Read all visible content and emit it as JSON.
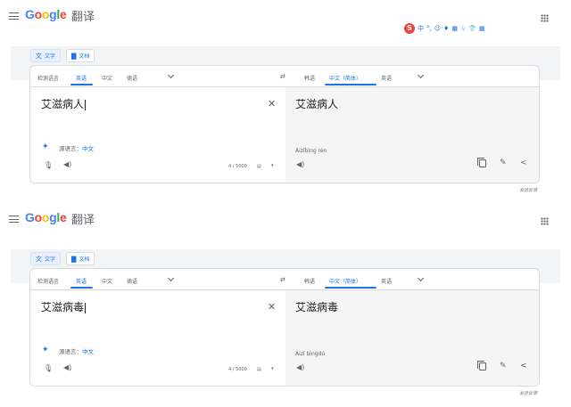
{
  "header": {
    "logo_parts": [
      "G",
      "o",
      "o",
      "g",
      "l",
      "e"
    ],
    "product": "翻译",
    "ime": {
      "brand": "S",
      "items": [
        "中",
        "°,",
        "☺",
        "♦",
        "▦",
        "♧",
        "👕",
        "▦"
      ]
    }
  },
  "modes": {
    "text": "文字",
    "docs": "文档"
  },
  "panels": [
    {
      "source_tabs": [
        "检测语言",
        "英语",
        "中文",
        "德语"
      ],
      "source_active": 1,
      "target_tabs": [
        "韩语",
        "中文（简体）",
        "英语"
      ],
      "target_active": 1,
      "source_text": "艾滋病人",
      "detected_label": "源语言：",
      "detected_lang": "中文",
      "char_count": "4 / 5000",
      "target_text": "艾滋病人",
      "pinyin": "Àizībìng rén",
      "feedback": "发送反馈"
    },
    {
      "source_tabs": [
        "检测语言",
        "英语",
        "中文",
        "德语"
      ],
      "source_active": 1,
      "target_tabs": [
        "韩语",
        "中文（简体）",
        "英语"
      ],
      "target_active": 1,
      "source_text": "艾滋病毒",
      "detected_label": "源语言：",
      "detected_lang": "中文",
      "char_count": "4 / 5000",
      "target_text": "艾滋病毒",
      "pinyin": "Àizī bìngdú",
      "feedback": "发送反馈"
    }
  ],
  "colors": {
    "accent": "#1a73e8",
    "target_bg": "#f5f5f5",
    "modebar_bg": "#f1f3f4"
  },
  "icons": [
    "menu-icon",
    "apps-icon",
    "translate-icon",
    "document-icon",
    "swap-icon",
    "chevron-down-icon",
    "close-icon",
    "sparkle-icon",
    "mic-icon",
    "speaker-icon",
    "keyboard-icon",
    "copy-icon",
    "edit-icon",
    "share-icon"
  ]
}
